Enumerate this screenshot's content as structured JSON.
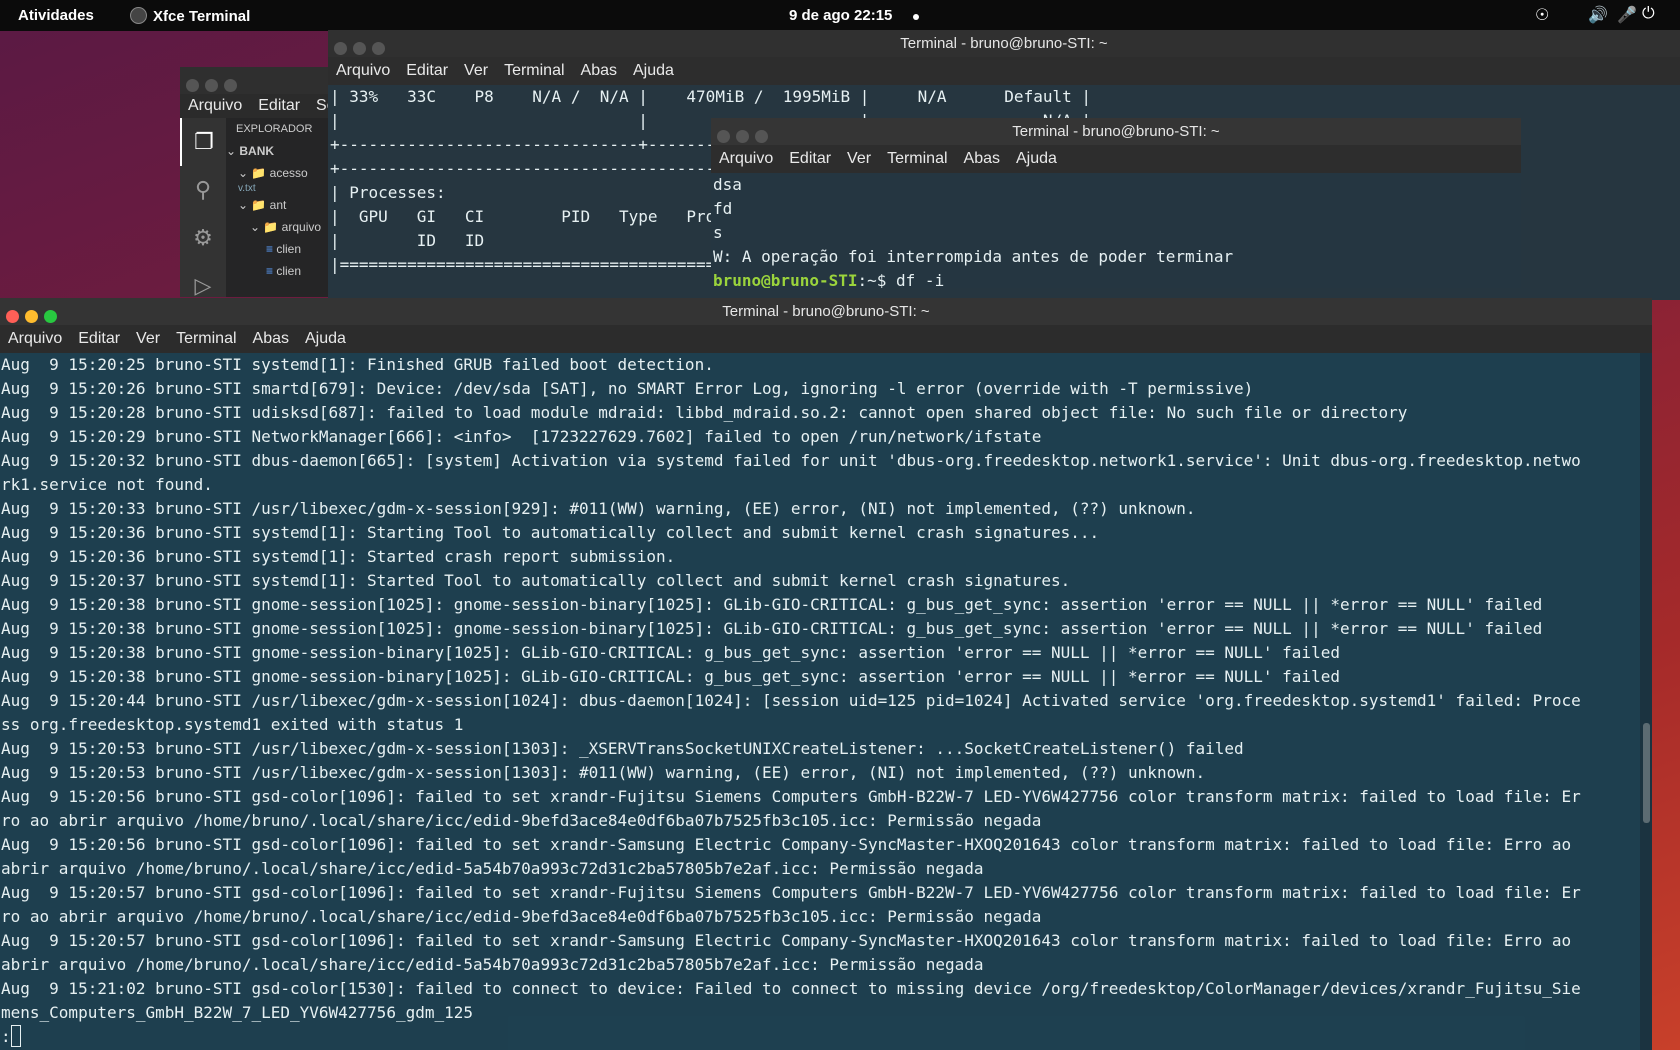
{
  "topbar": {
    "activities": "Atividades",
    "app_name": "Xfce Terminal",
    "clock": "9 de ago  22:15"
  },
  "code_window": {
    "menu": [
      "Arquivo",
      "Editar",
      "Sel"
    ],
    "explorer_title": "EXPLORADOR",
    "tree": [
      "BANK",
      "acesso",
      "v.txt",
      "ant",
      "arquivo",
      "clien",
      "clien"
    ]
  },
  "win1": {
    "title": "Terminal - bruno@bruno-STI: ~",
    "menu": [
      "Arquivo",
      "Editar",
      "Ver",
      "Terminal",
      "Abas",
      "Ajuda"
    ],
    "lines": [
      "| 33%   33C    P8    N/A /  N/A |    470MiB /  1995MiB |     N/A      Default |",
      "|                               |                      |                  N/A |",
      "+-------------------------------+----------------------+----------------------+",
      "",
      "+-----------------------------------------------------------------------------+",
      "| Processes:                                                                  |",
      "|  GPU   GI   CI        PID   Type   Process name                  GPU Memory |",
      "|        ID   ID                                                   Usage      |",
      "|=============================================================================|"
    ]
  },
  "win2": {
    "title": "Terminal - bruno@bruno-STI: ~",
    "menu": [
      "Arquivo",
      "Editar",
      "Ver",
      "Terminal",
      "Abas",
      "Ajuda"
    ],
    "lines": [
      "dsa",
      "fd",
      "s",
      "W: A operação foi interrompida antes de poder terminar"
    ],
    "prompt_user": "bruno@bruno-STI",
    "prompt_rest": ":~$ df -i"
  },
  "win3": {
    "title": "Terminal - bruno@bruno-STI: ~",
    "menu": [
      "Arquivo",
      "Editar",
      "Ver",
      "Terminal",
      "Abas",
      "Ajuda"
    ],
    "lines": [
      "Aug  9 15:20:25 bruno-STI systemd[1]: Finished GRUB failed boot detection.",
      "Aug  9 15:20:26 bruno-STI smartd[679]: Device: /dev/sda [SAT], no SMART Error Log, ignoring -l error (override with -T permissive)",
      "Aug  9 15:20:28 bruno-STI udisksd[687]: failed to load module mdraid: libbd_mdraid.so.2: cannot open shared object file: No such file or directory",
      "Aug  9 15:20:29 bruno-STI NetworkManager[666]: <info>  [1723227629.7602] failed to open /run/network/ifstate",
      "Aug  9 15:20:32 bruno-STI dbus-daemon[665]: [system] Activation via systemd failed for unit 'dbus-org.freedesktop.network1.service': Unit dbus-org.freedesktop.netwo",
      "rk1.service not found.",
      "Aug  9 15:20:33 bruno-STI /usr/libexec/gdm-x-session[929]: #011(WW) warning, (EE) error, (NI) not implemented, (??) unknown.",
      "Aug  9 15:20:36 bruno-STI systemd[1]: Starting Tool to automatically collect and submit kernel crash signatures...",
      "Aug  9 15:20:36 bruno-STI systemd[1]: Started crash report submission.",
      "Aug  9 15:20:37 bruno-STI systemd[1]: Started Tool to automatically collect and submit kernel crash signatures.",
      "Aug  9 15:20:38 bruno-STI gnome-session[1025]: gnome-session-binary[1025]: GLib-GIO-CRITICAL: g_bus_get_sync: assertion 'error == NULL || *error == NULL' failed",
      "Aug  9 15:20:38 bruno-STI gnome-session[1025]: gnome-session-binary[1025]: GLib-GIO-CRITICAL: g_bus_get_sync: assertion 'error == NULL || *error == NULL' failed",
      "Aug  9 15:20:38 bruno-STI gnome-session-binary[1025]: GLib-GIO-CRITICAL: g_bus_get_sync: assertion 'error == NULL || *error == NULL' failed",
      "Aug  9 15:20:38 bruno-STI gnome-session-binary[1025]: GLib-GIO-CRITICAL: g_bus_get_sync: assertion 'error == NULL || *error == NULL' failed",
      "Aug  9 15:20:44 bruno-STI /usr/libexec/gdm-x-session[1024]: dbus-daemon[1024]: [session uid=125 pid=1024] Activated service 'org.freedesktop.systemd1' failed: Proce",
      "ss org.freedesktop.systemd1 exited with status 1",
      "Aug  9 15:20:53 bruno-STI /usr/libexec/gdm-x-session[1303]: _XSERVTransSocketUNIXCreateListener: ...SocketCreateListener() failed",
      "Aug  9 15:20:53 bruno-STI /usr/libexec/gdm-x-session[1303]: #011(WW) warning, (EE) error, (NI) not implemented, (??) unknown.",
      "Aug  9 15:20:56 bruno-STI gsd-color[1096]: failed to set xrandr-Fujitsu Siemens Computers GmbH-B22W-7 LED-YV6W427756 color transform matrix: failed to load file: Er",
      "ro ao abrir arquivo /home/bruno/.local/share/icc/edid-9befd3ace84e0df6ba07b7525fb3c105.icc: Permissão negada",
      "Aug  9 15:20:56 bruno-STI gsd-color[1096]: failed to set xrandr-Samsung Electric Company-SyncMaster-HXOQ201643 color transform matrix: failed to load file: Erro ao",
      "abrir arquivo /home/bruno/.local/share/icc/edid-5a54b70a993c72d31c2ba57805b7e2af.icc: Permissão negada",
      "Aug  9 15:20:57 bruno-STI gsd-color[1096]: failed to set xrandr-Fujitsu Siemens Computers GmbH-B22W-7 LED-YV6W427756 color transform matrix: failed to load file: Er",
      "ro ao abrir arquivo /home/bruno/.local/share/icc/edid-9befd3ace84e0df6ba07b7525fb3c105.icc: Permissão negada",
      "Aug  9 15:20:57 bruno-STI gsd-color[1096]: failed to set xrandr-Samsung Electric Company-SyncMaster-HXOQ201643 color transform matrix: failed to load file: Erro ao",
      "abrir arquivo /home/bruno/.local/share/icc/edid-5a54b70a993c72d31c2ba57805b7e2af.icc: Permissão negada",
      "Aug  9 15:21:02 bruno-STI gsd-color[1530]: failed to connect to device: Failed to connect to missing device /org/freedesktop/ColorManager/devices/xrandr_Fujitsu_Sie",
      "mens_Computers_GmbH_B22W_7_LED_YV6W427756_gdm_125"
    ],
    "pager_prompt": ":"
  },
  "colors": {
    "close": "#ff5f57",
    "minimize": "#febc2e",
    "maximize": "#28c840",
    "prompt_green": "#9bd43c"
  }
}
